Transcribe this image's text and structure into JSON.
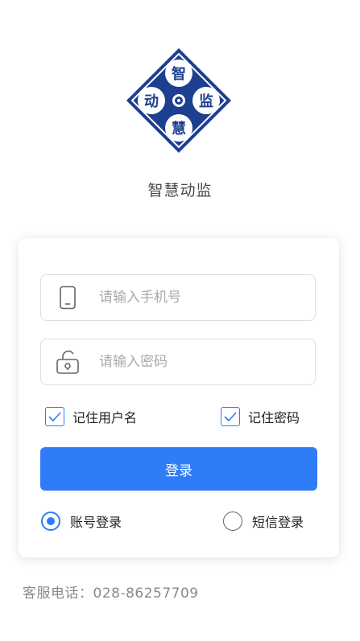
{
  "logo": {
    "chars": [
      "智",
      "动",
      "监",
      "慧"
    ],
    "color": "#1d3f8f"
  },
  "app_name": "智慧动监",
  "login_form": {
    "phone": {
      "placeholder": "请输入手机号",
      "value": "",
      "icon": "phone-icon"
    },
    "password": {
      "placeholder": "请输入密码",
      "value": "",
      "icon": "unlock-icon"
    },
    "remember_username": {
      "label": "记住用户名",
      "checked": true
    },
    "remember_password": {
      "label": "记住密码",
      "checked": true
    },
    "login_button": "登录",
    "login_modes": [
      {
        "label": "账号登录",
        "selected": true
      },
      {
        "label": "短信登录",
        "selected": false
      }
    ]
  },
  "service_phone": "客服电话：028-86257709",
  "colors": {
    "accent": "#2f7cf6",
    "logo": "#1d3f8f"
  }
}
